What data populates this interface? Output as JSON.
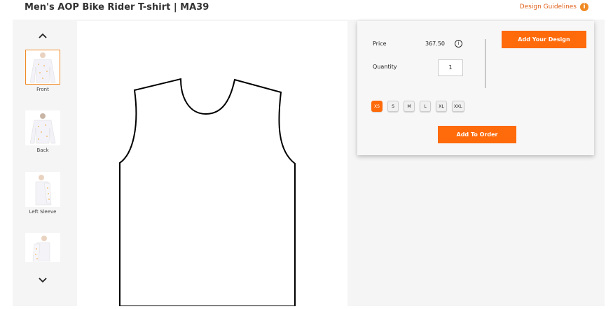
{
  "header": {
    "title": "Men's AOP Bike Rider T-shirt | MA39",
    "guidelines_label": "Design Guidelines",
    "guidelines_icon": "i"
  },
  "thumbnails": [
    {
      "label": "Front",
      "active": true
    },
    {
      "label": "Back",
      "active": false
    },
    {
      "label": "Left Sleeve",
      "active": false
    },
    {
      "label": "",
      "active": false
    }
  ],
  "panel": {
    "price_label": "Price",
    "price_value": "367.50",
    "price_info_icon": "i",
    "quantity_label": "Quantity",
    "quantity_value": "1",
    "add_design_label": "Add Your Design",
    "sizes": [
      "XS",
      "S",
      "M",
      "L",
      "XL",
      "XXL"
    ],
    "selected_size": "XS",
    "add_order_label": "Add To Order"
  },
  "colors": {
    "accent": "#ff6a0a",
    "link": "#e0621b",
    "workspace": "#f5f5f5"
  }
}
